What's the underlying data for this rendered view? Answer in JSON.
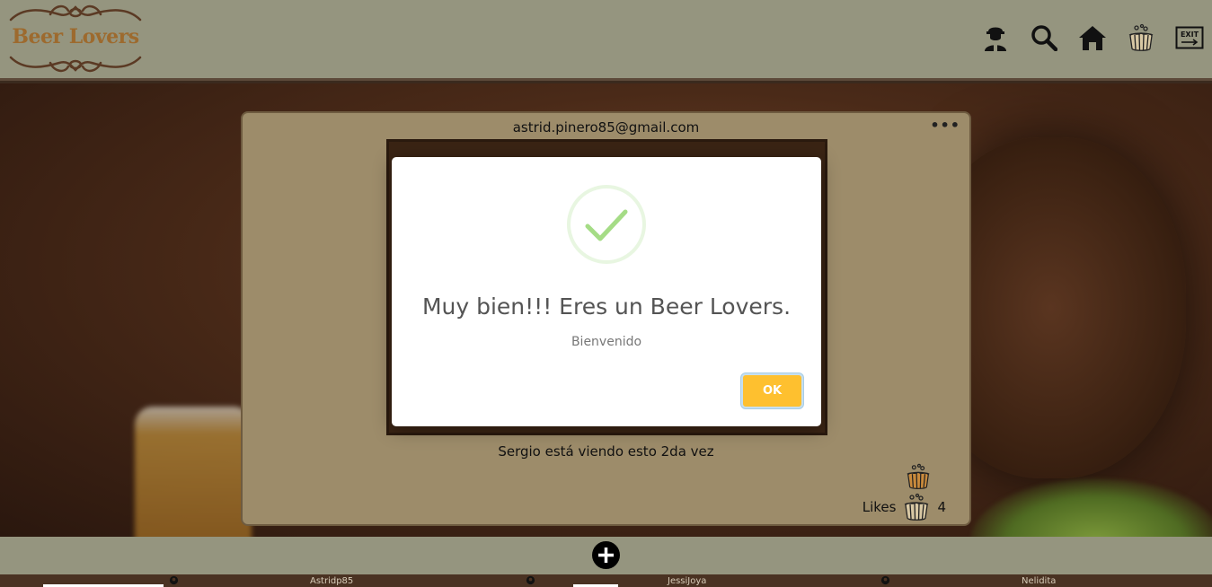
{
  "header": {
    "logo_text": "Beer Lovers",
    "nav": [
      {
        "icon": "user-icon"
      },
      {
        "icon": "search-icon"
      },
      {
        "icon": "home-icon"
      },
      {
        "icon": "beer-barrel-icon"
      },
      {
        "icon": "exit-icon",
        "label": "EXIT"
      }
    ]
  },
  "post": {
    "author": "astrid.pinero85@gmail.com",
    "menu": "•••",
    "caption": "Sergio está viendo esto 2da vez",
    "likes_label": "Likes",
    "likes_count": "4"
  },
  "modal": {
    "title": "Muy bien!!! Eres un Beer Lovers.",
    "text": "Bienvenido",
    "ok_label": "OK",
    "icon": "success-check-icon"
  },
  "footer": {
    "links": [
      "Astridp85",
      "JessiJoya",
      "Nelidita"
    ]
  },
  "colors": {
    "header_bg": "#95957f",
    "card_bg": "#9d8c6a",
    "ok_button": "#fec02f",
    "check": "#a5dc86",
    "logo": "#9d6a2e"
  }
}
